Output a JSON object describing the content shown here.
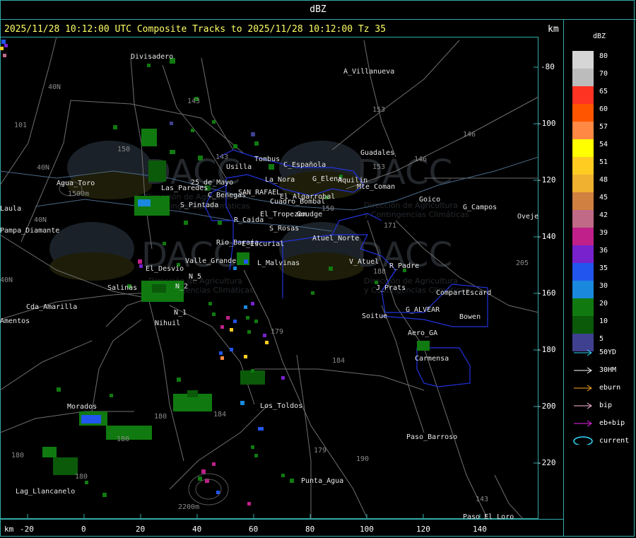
{
  "topbar": {
    "title": "dBZ"
  },
  "info": {
    "text": "2025/11/28 10:12:00 UTC Composite Tracks to 2025/11/28 10:12:00 Tz 35",
    "km_label": "km"
  },
  "legend": {
    "title": "dBZ",
    "levels": [
      {
        "label": "80",
        "color": "#d6d6d6"
      },
      {
        "label": "70",
        "color": "#bcbcbc"
      },
      {
        "label": "65",
        "color": "#ff3322"
      },
      {
        "label": "60",
        "color": "#ff5500"
      },
      {
        "label": "57",
        "color": "#ff8844"
      },
      {
        "label": "54",
        "color": "#ffff00"
      },
      {
        "label": "51",
        "color": "#ffcc22"
      },
      {
        "label": "48",
        "color": "#f0b030"
      },
      {
        "label": "45",
        "color": "#d08040"
      },
      {
        "label": "42",
        "color": "#c06a88"
      },
      {
        "label": "39",
        "color": "#c0208a"
      },
      {
        "label": "36",
        "color": "#7722cc"
      },
      {
        "label": "35",
        "color": "#2255ee"
      },
      {
        "label": "30",
        "color": "#1a88dd"
      },
      {
        "label": "20",
        "color": "#107a10"
      },
      {
        "label": "10",
        "color": "#0a5a0a"
      },
      {
        "label": "5",
        "color": "#404090"
      }
    ],
    "tracks": [
      {
        "label": "50YD",
        "color": "#33ddff"
      },
      {
        "label": "30HM",
        "color": "#ffffff"
      },
      {
        "label": "eburn",
        "color": "#ffaa22"
      },
      {
        "label": "bip",
        "color": "#ffbbdd"
      },
      {
        "label": "eb+bip",
        "color": "#ee22ee"
      },
      {
        "label": "current",
        "color": "#33ddff"
      }
    ]
  },
  "axes": {
    "x_label": "km",
    "x_ticks": [
      "-20",
      "0",
      "20",
      "40",
      "60",
      "80",
      "100",
      "120",
      "140"
    ],
    "y_ticks": [
      "-80",
      "-100",
      "-120",
      "-140",
      "-160",
      "-180",
      "-200",
      "-220"
    ]
  },
  "places": [
    "Divisadero",
    "A_Villanueva",
    "Guadales",
    "Tombus",
    "Usilla",
    "C_Española",
    "G_Elena",
    "Aquilin",
    "Mte_Coman",
    "La_Nora",
    "SAN_RAFAEL",
    "El_Algarrobal",
    "C_Benegas",
    "Cuadro_Bombal",
    "Rio_Baraja",
    "S_Pintada",
    "25_de_Mayo",
    "Las_Paredes",
    "Agua_Toro",
    "Pampa_Diamante",
    "Laula",
    "El_Tropezon",
    "Goudge",
    "R_Caida",
    "S_Rosas",
    "Atuel_Norte",
    "E_Escurial",
    "Valle_Grande",
    "L_Malvinas",
    "El_Desvio",
    "Salinas",
    "N_5",
    "N_2",
    "N_1",
    "Nihuil",
    "Cda_Amarilla",
    "Amentos",
    "V_Atuel",
    "R_Padre",
    "J_Prats",
    "CompartEscard",
    "G_ALVEAR",
    "Soitue",
    "Bowen",
    "Goico",
    "G_Campos",
    "Ovejero",
    "Aero_GA",
    "Carmensa",
    "Los_Toldos",
    "Morados",
    "Paso_Barroso",
    "Punta_Agua",
    "Lag_Llancanelo",
    "Paso_El_Loro",
    "40N",
    "40N",
    "40N",
    "40N",
    "101",
    "143",
    "143",
    "150",
    "150",
    "153",
    "153",
    "146",
    "146",
    "171",
    "179",
    "184",
    "184",
    "188",
    "179",
    "180",
    "180",
    "180",
    "180",
    "143",
    "205",
    "1500m",
    "2200m",
    "190"
  ],
  "watermark": {
    "brand": "DACC",
    "line1": "Dirección de Agricultura",
    "line2": "y Contingencias Climáticas"
  }
}
